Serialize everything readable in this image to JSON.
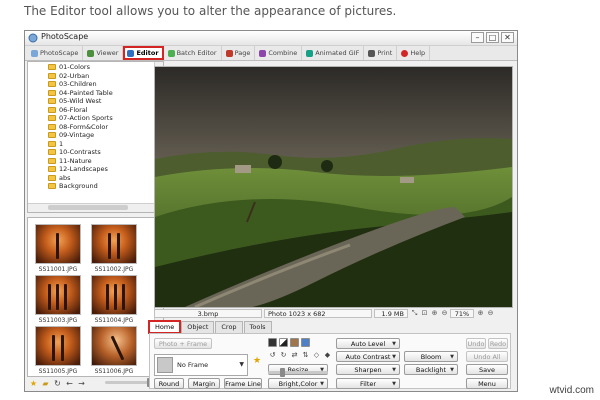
{
  "caption": "The Editor tool allows you to alter the appearance of pictures.",
  "window": {
    "title": "PhotoScape",
    "controls": [
      "–",
      "□",
      "✕"
    ]
  },
  "tabs": [
    {
      "label": "PhotoScape",
      "icon": "photoscape-icon",
      "color": "#7aa7d8",
      "active": false
    },
    {
      "label": "Viewer",
      "icon": "viewer-icon",
      "color": "#4c8f3c",
      "active": false
    },
    {
      "label": "Editor",
      "icon": "editor-icon",
      "color": "#2f6fc0",
      "active": true
    },
    {
      "label": "Batch Editor",
      "icon": "batch-editor-icon",
      "color": "#4caf50",
      "active": false
    },
    {
      "label": "Page",
      "icon": "page-icon",
      "color": "#c0392b",
      "active": false
    },
    {
      "label": "Combine",
      "icon": "combine-icon",
      "color": "#8e44ad",
      "active": false
    },
    {
      "label": "Animated GIF",
      "icon": "gif-icon",
      "color": "#16a085",
      "active": false
    },
    {
      "label": "Print",
      "icon": "print-icon",
      "color": "#555555",
      "active": false
    },
    {
      "label": "Help",
      "icon": "help-icon",
      "color": "#d42525",
      "active": false
    }
  ],
  "folder_tree": {
    "items": [
      "01-Colors",
      "02-Urban",
      "03-Children",
      "04-Painted Table",
      "05-Wild West",
      "06-Floral",
      "07-Action Sports",
      "08-Form&Color",
      "09-Vintage",
      "1",
      "10-Contrasts",
      "11-Nature",
      "12-Landscapes",
      "abs",
      "Background"
    ]
  },
  "thumbnails": [
    {
      "file": "SS11001.JPG"
    },
    {
      "file": "SS11002.JPG"
    },
    {
      "file": "SS11003.JPG"
    },
    {
      "file": "SS11004.JPG"
    },
    {
      "file": "SS11005.JPG"
    },
    {
      "file": "SS11006.JPG"
    }
  ],
  "status": {
    "filename": "3.bmp",
    "photo_info": "Photo 1023 x 682",
    "file_size": "1.9 MB",
    "zoom": "71%"
  },
  "editor_tabs": [
    {
      "label": "Home",
      "active": true
    },
    {
      "label": "Object",
      "active": false
    },
    {
      "label": "Crop",
      "active": false
    },
    {
      "label": "Tools",
      "active": false
    }
  ],
  "home_panel": {
    "photo_frame_label": "Photo + Frame",
    "frame_value": "No Frame",
    "round_label": "Round",
    "margin_label": "Margin",
    "frame_line_label": "Frame Line",
    "resize_label": "Resize",
    "bright_color_label": "Bright,Color",
    "auto_level_label": "Auto Level",
    "auto_contrast_label": "Auto Contrast",
    "sharpen_label": "Sharpen",
    "filter_label": "Filter",
    "bloom_label": "Bloom",
    "backlight_label": "Backlight",
    "undo_label": "Undo",
    "redo_label": "Redo",
    "undo_all_label": "Undo All",
    "save_label": "Save",
    "menu_label": "Menu"
  },
  "watermark": "wtvid.com"
}
